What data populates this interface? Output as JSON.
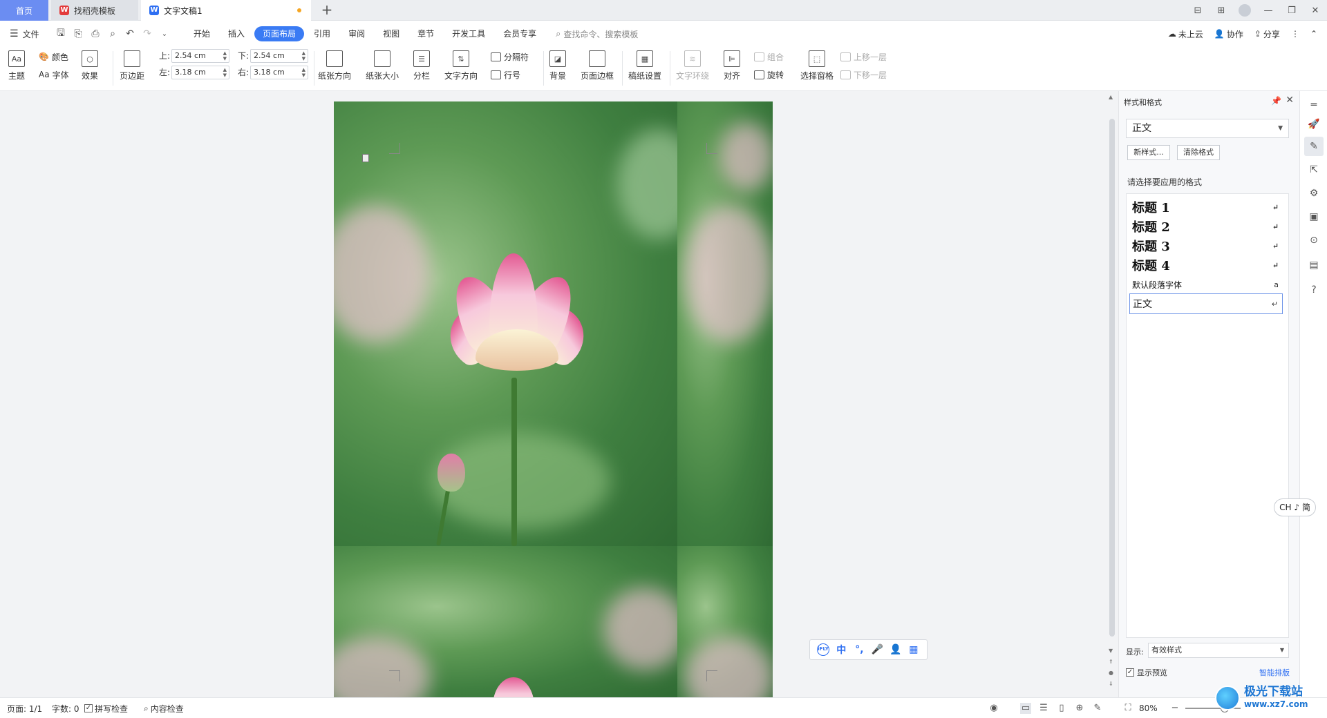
{
  "titlebar": {
    "tabs": [
      {
        "label": "首页"
      },
      {
        "label": "找稻壳模板"
      },
      {
        "label": "文字文稿1"
      }
    ],
    "add_tab": "+",
    "window_controls": [
      "⊟",
      "⊞",
      "",
      "—",
      "❐",
      "✕"
    ]
  },
  "menubar": {
    "file": "文件",
    "tabs": [
      "开始",
      "插入",
      "页面布局",
      "引用",
      "审阅",
      "视图",
      "章节",
      "开发工具",
      "会员专享"
    ],
    "active_tab": "页面布局",
    "search": "查找命令、搜索模板",
    "right": {
      "cloud": "未上云",
      "collab": "协作",
      "share": "分享"
    }
  },
  "ribbon": {
    "theme": "主题",
    "color": "颜色",
    "font": "字体",
    "effect": "效果",
    "margin": "页边距",
    "margin_top_label": "上:",
    "margin_top": "2.54 cm",
    "margin_bottom_label": "下:",
    "margin_bottom": "2.54 cm",
    "margin_left_label": "左:",
    "margin_left": "3.18 cm",
    "margin_right_label": "右:",
    "margin_right": "3.18 cm",
    "orientation": "纸张方向",
    "size": "纸张大小",
    "columns": "分栏",
    "text_direction": "文字方向",
    "breaks": "分隔符",
    "line_numbers": "行号",
    "background": "背景",
    "page_border": "页面边框",
    "manuscript": "稿纸设置",
    "text_wrap": "文字环绕",
    "align": "对齐",
    "group": "组合",
    "rotate": "旋转",
    "selection_pane": "选择窗格",
    "bring_forward": "上移一层",
    "send_backward": "下移一层"
  },
  "ime": {
    "items": [
      "iFLY",
      "中",
      "°,",
      "🎤",
      "👤",
      "▦"
    ]
  },
  "panel": {
    "title": "样式和格式",
    "current_style": "正文",
    "new_style": "新样式...",
    "clear_format": "清除格式",
    "hint": "请选择要应用的格式",
    "styles": [
      {
        "label": "标题 1",
        "mark": "↵"
      },
      {
        "label": "标题 2",
        "mark": "↵"
      },
      {
        "label": "标题 3",
        "mark": "↵"
      },
      {
        "label": "标题 4",
        "mark": "↵"
      },
      {
        "label": "默认段落字体",
        "mark": "a"
      },
      {
        "label": "正文",
        "mark": "↵"
      }
    ],
    "show_label": "显示:",
    "show_value": "有效样式",
    "show_preview": "显示预览",
    "smart_layout": "智能排版"
  },
  "ch_toggle": "CH ♪ 简",
  "status": {
    "page": "页面: 1/1",
    "words": "字数: 0",
    "spell": "拼写检查",
    "content_check": "内容检查",
    "zoom": "80%"
  },
  "watermark": {
    "line1": "极光下载站",
    "line2": "www.xz7.com"
  },
  "colors": {
    "accent": "#3a7bf4",
    "home_tab": "#6b8df2",
    "panel_bg": "#f7f8fa",
    "workspace_bg": "#f2f3f5"
  }
}
